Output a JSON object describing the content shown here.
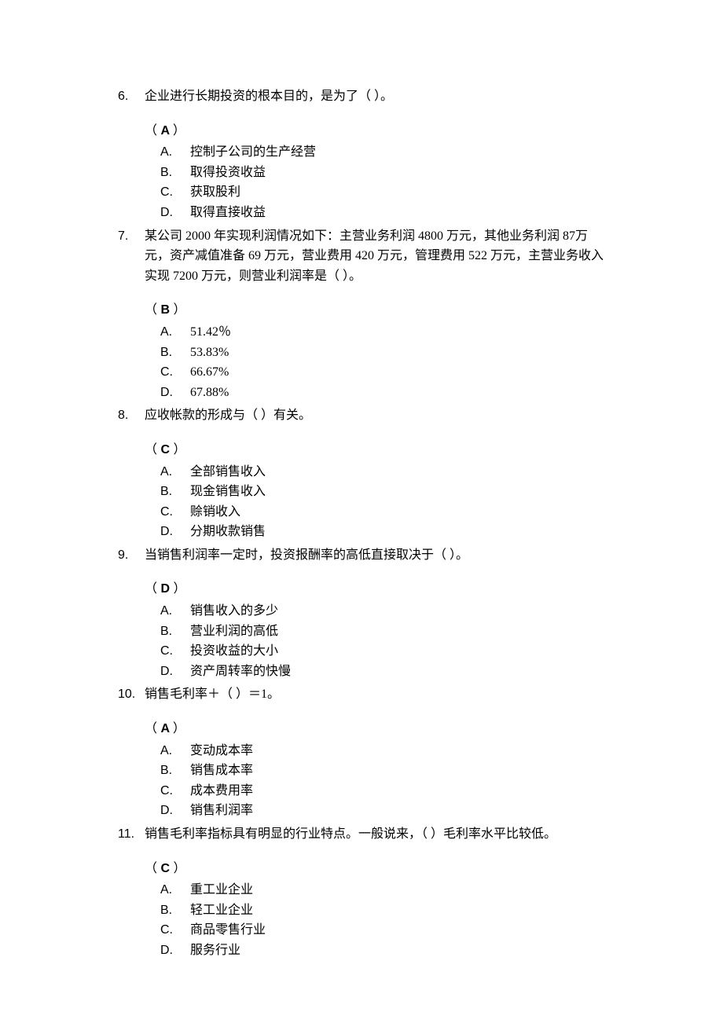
{
  "questions": [
    {
      "number": "6.",
      "text": "企业进行长期投资的根本目的，是为了（ ）。",
      "answer": "A",
      "options": [
        {
          "label": "A.",
          "text": "控制子公司的生产经营"
        },
        {
          "label": "B.",
          "text": "取得投资收益"
        },
        {
          "label": "C.",
          "text": "获取股利"
        },
        {
          "label": "D.",
          "text": "取得直接收益"
        }
      ]
    },
    {
      "number": "7.",
      "text": "某公司 2000 年实现利润情况如下：主营业务利润 4800 万元，其他业务利润 87万元，资产减值准备 69 万元，营业费用 420 万元，管理费用 522 万元，主营业务收入实现 7200 万元，则营业利润率是（ ）。",
      "answer": "B",
      "options": [
        {
          "label": "A.",
          "text": "51.42％"
        },
        {
          "label": "B.",
          "text": "53.83%"
        },
        {
          "label": "C.",
          "text": "66.67%"
        },
        {
          "label": "D.",
          "text": "67.88%"
        }
      ]
    },
    {
      "number": "8.",
      "text": "应收帐款的形成与（ ）有关。",
      "answer": "C",
      "options": [
        {
          "label": "A.",
          "text": "全部销售收入"
        },
        {
          "label": "B.",
          "text": "现金销售收入"
        },
        {
          "label": "C.",
          "text": "赊销收入"
        },
        {
          "label": "D.",
          "text": "分期收款销售"
        }
      ]
    },
    {
      "number": "9.",
      "text": "当销售利润率一定时，投资报酬率的高低直接取决于（ ）。",
      "answer": "D",
      "options": [
        {
          "label": "A.",
          "text": "销售收入的多少"
        },
        {
          "label": "B.",
          "text": "营业利润的高低"
        },
        {
          "label": "C.",
          "text": "投资收益的大小"
        },
        {
          "label": "D.",
          "text": "资产周转率的快慢"
        }
      ]
    },
    {
      "number": "10.",
      "text": "销售毛利率＋（ ）＝1。",
      "answer": "A",
      "options": [
        {
          "label": "A.",
          "text": "变动成本率"
        },
        {
          "label": "B.",
          "text": "销售成本率"
        },
        {
          "label": "C.",
          "text": "成本费用率"
        },
        {
          "label": "D.",
          "text": "销售利润率"
        }
      ]
    },
    {
      "number": "11.",
      "text": "销售毛利率指标具有明显的行业特点。一般说来，（  ）毛利率水平比较低。",
      "answer": "C",
      "options": [
        {
          "label": "A.",
          "text": "重工业企业"
        },
        {
          "label": "B.",
          "text": "轻工业企业"
        },
        {
          "label": "C.",
          "text": "商品零售行业"
        },
        {
          "label": "D.",
          "text": "服务行业"
        }
      ]
    }
  ],
  "paren_left": "（",
  "paren_right": "）"
}
